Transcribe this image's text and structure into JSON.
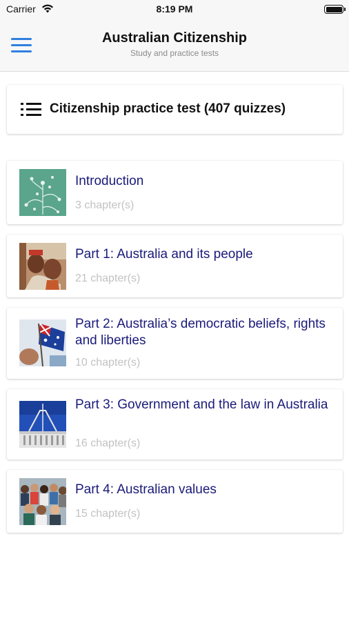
{
  "status_bar": {
    "carrier": "Carrier",
    "time": "8:19 PM"
  },
  "nav": {
    "title": "Australian Citizenship",
    "subtitle": "Study and practice tests"
  },
  "practice_test": {
    "label": "Citizenship practice test (407 quizzes)",
    "icon": "list-icon"
  },
  "chapters": [
    {
      "title": "Introduction",
      "count": "3 chapter(s)",
      "thumbnail": "wattle-pattern-image"
    },
    {
      "title": "Part 1: Australia and its people",
      "count": "21 chapter(s)",
      "thumbnail": "aboriginal-people-image"
    },
    {
      "title": "Part 2: Australia’s democratic beliefs, rights and liberties",
      "count": "10 chapter(s)",
      "thumbnail": "australian-flag-image"
    },
    {
      "title": "Part 3: Government and the law in Australia",
      "count": "16 chapter(s)",
      "thumbnail": "parliament-house-image"
    },
    {
      "title": "Part 4: Australian values",
      "count": "15 chapter(s)",
      "thumbnail": "group-of-people-image"
    }
  ],
  "colors": {
    "accent": "#2f7fe0",
    "chapter_title": "#1a1a7a",
    "muted": "#c2c2c2"
  }
}
